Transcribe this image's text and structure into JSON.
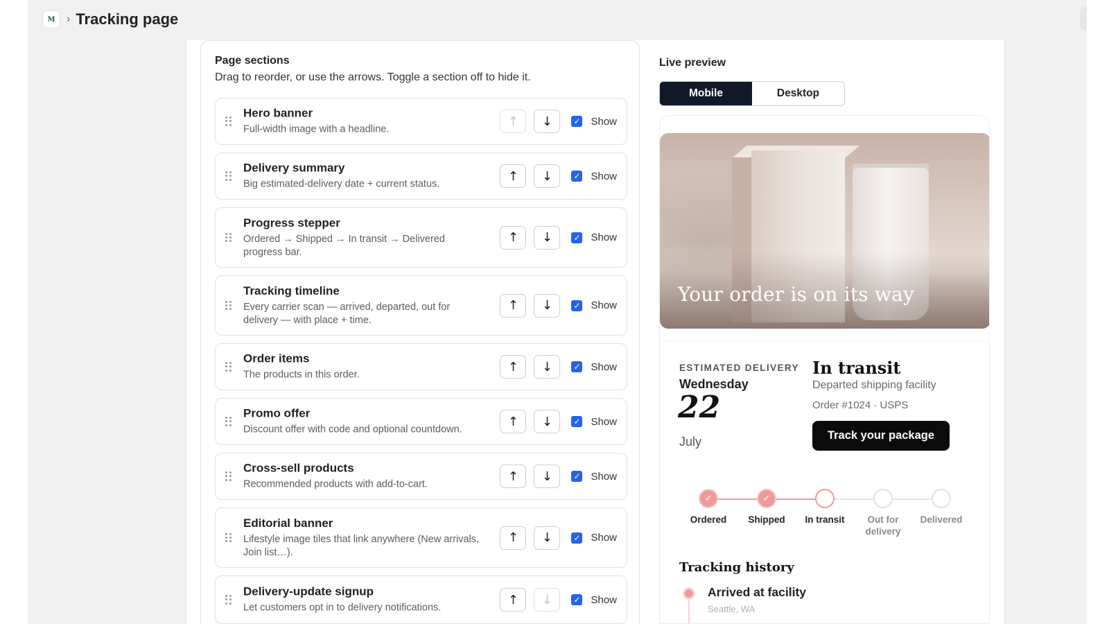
{
  "header": {
    "app_logo": "M",
    "breadcrumb_separator": "›",
    "title": "Tracking page"
  },
  "sections_panel": {
    "title": "Page sections",
    "description": "Drag to reorder, or use the arrows. Toggle a section off to hide it.",
    "show_label": "Show",
    "up_arrow": "↑",
    "down_arrow": "↓",
    "sections": [
      {
        "name": "Hero banner",
        "description": "Full-width image with a headline.",
        "shown": true,
        "up_disabled": true,
        "down_disabled": false
      },
      {
        "name": "Delivery summary",
        "description": "Big estimated-delivery date + current status.",
        "shown": true,
        "up_disabled": false,
        "down_disabled": false
      },
      {
        "name": "Progress stepper",
        "description": "Ordered → Shipped → In transit → Delivered progress bar.",
        "shown": true,
        "up_disabled": false,
        "down_disabled": false
      },
      {
        "name": "Tracking timeline",
        "description": "Every carrier scan — arrived, departed, out for delivery — with place + time.",
        "shown": true,
        "up_disabled": false,
        "down_disabled": false
      },
      {
        "name": "Order items",
        "description": "The products in this order.",
        "shown": true,
        "up_disabled": false,
        "down_disabled": false
      },
      {
        "name": "Promo offer",
        "description": "Discount offer with code and optional countdown.",
        "shown": true,
        "up_disabled": false,
        "down_disabled": false
      },
      {
        "name": "Cross-sell products",
        "description": "Recommended products with add-to-cart.",
        "shown": true,
        "up_disabled": false,
        "down_disabled": false
      },
      {
        "name": "Editorial banner",
        "description": "Lifestyle image tiles that link anywhere (New arrivals, Join list…).",
        "shown": true,
        "up_disabled": false,
        "down_disabled": false
      },
      {
        "name": "Delivery-update signup",
        "description": "Let customers opt in to delivery notifications.",
        "shown": true,
        "up_disabled": false,
        "down_disabled": true
      }
    ]
  },
  "preview": {
    "title": "Live preview",
    "modes": [
      "Mobile",
      "Desktop"
    ],
    "active_mode": "Mobile",
    "hero_headline": "Your order is on its way",
    "delivery": {
      "label": "ESTIMATED DELIVERY",
      "weekday": "Wednesday",
      "day": "22",
      "month": "July",
      "status": "In transit",
      "status_detail": "Departed shipping facility",
      "order_line": "Order #1024 · USPS",
      "track_button": "Track your package"
    },
    "stepper": {
      "steps": [
        {
          "label": "Ordered",
          "state": "done"
        },
        {
          "label": "Shipped",
          "state": "done"
        },
        {
          "label": "In transit",
          "state": "current"
        },
        {
          "label": "Out for delivery",
          "state": "todo"
        },
        {
          "label": "Delivered",
          "state": "todo"
        }
      ],
      "check_glyph": "✓"
    },
    "history": {
      "title": "Tracking history",
      "first_event": "Arrived at facility",
      "first_place": "Seattle, WA"
    },
    "accent_color": "#ef9a9a"
  },
  "colors": {
    "checkbox": "#2563eb",
    "toggle_active": "#111827",
    "button_dark": "#0b0b0b"
  }
}
